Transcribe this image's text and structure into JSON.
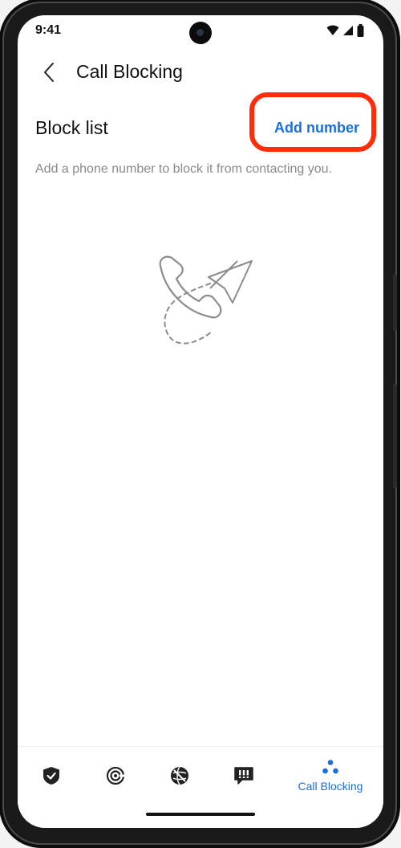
{
  "status_bar": {
    "time": "9:41",
    "icons": [
      "wifi-icon",
      "cellular-signal-icon",
      "battery-icon"
    ]
  },
  "app_bar": {
    "back_icon": "chevron-left-icon",
    "title": "Call Blocking"
  },
  "block_list": {
    "title": "Block list",
    "add_button_label": "Add number",
    "description": "Add a phone number to block it from contacting you.",
    "empty_illustration": "phone-with-paper-plane-illustration"
  },
  "bottom_nav": {
    "items": [
      {
        "icon": "shield-check-icon",
        "label": ""
      },
      {
        "icon": "target-icon",
        "label": ""
      },
      {
        "icon": "globe-slash-icon",
        "label": ""
      },
      {
        "icon": "message-alert-icon",
        "label": ""
      },
      {
        "icon": "dots-icon",
        "label": "Call Blocking",
        "selected": true
      }
    ]
  },
  "colors": {
    "accent": "#1a6fe0",
    "highlight": "#ff2d0a",
    "text_primary": "#111111",
    "text_secondary": "#8a8a8a"
  }
}
